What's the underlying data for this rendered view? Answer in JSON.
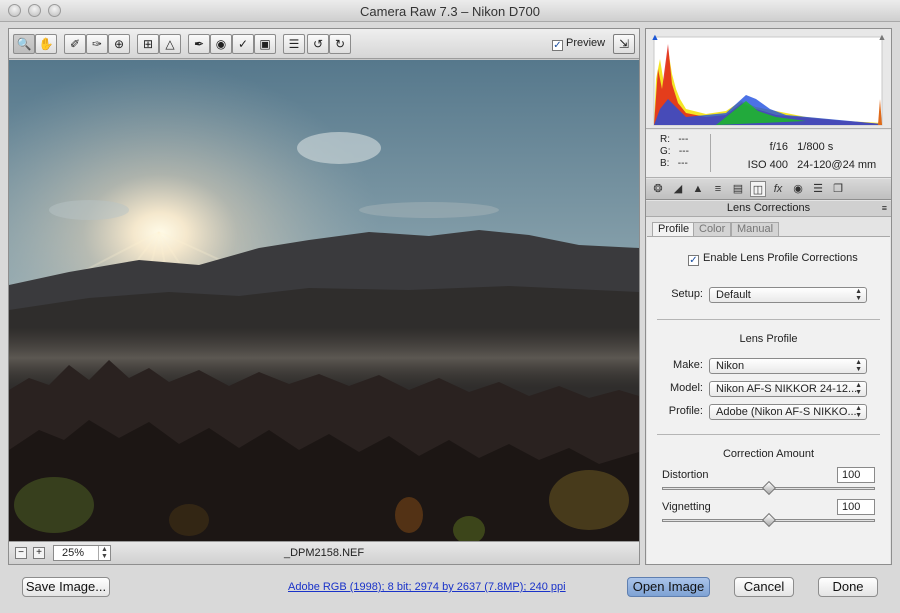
{
  "window": {
    "title": "Camera Raw 7.3  –  Nikon D700"
  },
  "toolbar": {
    "tools": [
      "zoom-tool",
      "hand-tool",
      "white-balance-tool",
      "color-sampler-tool",
      "targeted-adjustment-tool",
      "crop-tool",
      "straighten-tool",
      "spot-removal-tool",
      "red-eye-removal-tool",
      "adjustment-brush-tool",
      "graduated-filter-tool",
      "preferences",
      "rotate-ccw",
      "rotate-cw"
    ],
    "preview_label": "Preview",
    "preview_checked": true
  },
  "statusbar": {
    "zoom_value": "25%",
    "filename": "_DPM2158.NEF"
  },
  "info": {
    "r_label": "R:",
    "g_label": "G:",
    "b_label": "B:",
    "r_value": "---",
    "g_value": "---",
    "b_value": "---",
    "aperture": "f/16",
    "shutter": "1/800 s",
    "iso": "ISO 400",
    "lens": "24-120@24 mm"
  },
  "panel": {
    "title": "Lens Corrections",
    "tabs": [
      "Profile",
      "Color",
      "Manual"
    ],
    "selected_tab": "Profile",
    "enable_label": "Enable Lens Profile Corrections",
    "setup_label": "Setup:",
    "setup_value": "Default",
    "lens_profile_title": "Lens Profile",
    "make_label": "Make:",
    "make_value": "Nikon",
    "model_label": "Model:",
    "model_value": "Nikon AF-S NIKKOR 24-12...",
    "profile_label": "Profile:",
    "profile_value": "Adobe (Nikon AF-S NIKKO...",
    "correction_title": "Correction Amount",
    "distortion_label": "Distortion",
    "distortion_value": "100",
    "vignetting_label": "Vignetting",
    "vignetting_value": "100"
  },
  "bottom": {
    "save_label": "Save Image...",
    "workflow_link": "Adobe RGB (1998); 8 bit; 2974 by 2637 (7.8MP); 240 ppi",
    "open_label": "Open Image",
    "cancel_label": "Cancel",
    "done_label": "Done"
  },
  "colors": {
    "link": "#1a33c9",
    "primary_button": "#8fb0de",
    "sky_top": "#5d7f94",
    "sun": "#fff6dc"
  }
}
